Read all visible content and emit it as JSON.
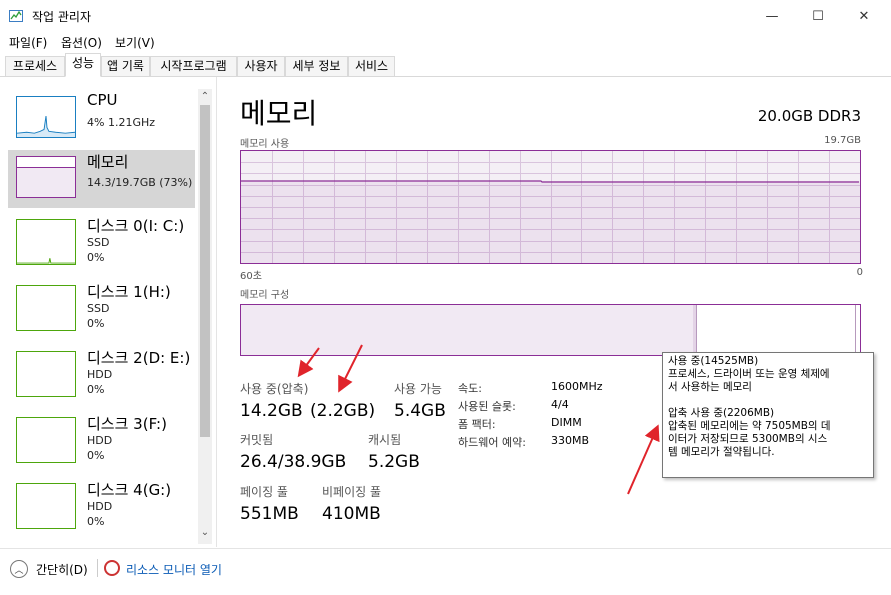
{
  "window": {
    "title": "작업 관리자",
    "minimize_icon": "—",
    "maximize_icon": "☐",
    "close_icon": "✕"
  },
  "menu": [
    "파일(F)",
    "옵션(O)",
    "보기(V)"
  ],
  "tabs": [
    "프로세스",
    "성능",
    "앱 기록",
    "시작프로그램",
    "사용자",
    "세부 정보",
    "서비스"
  ],
  "sidebar": {
    "items": [
      {
        "title": "CPU",
        "sub1": "4% 1.21GHz",
        "sub2": ""
      },
      {
        "title": "메모리",
        "sub1": "14.3/19.7GB (73%)",
        "sub2": ""
      },
      {
        "title": "디스크 0(I: C:)",
        "sub1": "SSD",
        "sub2": "0%"
      },
      {
        "title": "디스크 1(H:)",
        "sub1": "SSD",
        "sub2": "0%"
      },
      {
        "title": "디스크 2(D: E:)",
        "sub1": "HDD",
        "sub2": "0%"
      },
      {
        "title": "디스크 3(F:)",
        "sub1": "HDD",
        "sub2": "0%"
      },
      {
        "title": "디스크 4(G:)",
        "sub1": "HDD",
        "sub2": "0%"
      }
    ],
    "scroll_up": "⌃",
    "scroll_down": "⌄"
  },
  "main": {
    "title": "메모리",
    "spec": "20.0GB DDR3",
    "usage_label": "메모리 사용",
    "usage_max": "19.7GB",
    "usage_level": 0.73,
    "time_left": "60초",
    "time_right": "0",
    "composition_label": "메모리 구성",
    "stats": {
      "in_use_label": "사용 중(압축)",
      "in_use_value": "14.2GB",
      "compressed_value": "(2.2GB)",
      "available_label": "사용 가능",
      "available_value": "5.4GB",
      "committed_label": "커밋됨",
      "committed_value": "26.4/38.9GB",
      "cached_label": "캐시됨",
      "cached_value": "5.2GB",
      "paged_label": "페이징 풀",
      "paged_value": "551MB",
      "nonpaged_label": "비페이징 풀",
      "nonpaged_value": "410MB"
    },
    "specs": [
      {
        "key": "속도:",
        "value": "1600MHz"
      },
      {
        "key": "사용된 슬롯:",
        "value": "4/4"
      },
      {
        "key": "폼 팩터:",
        "value": "DIMM"
      },
      {
        "key": "하드웨어 예약:",
        "value": "330MB"
      }
    ]
  },
  "tooltip": {
    "line1": "사용 중(14525MB)",
    "line2": "프로세스, 드라이버 또는 운영 체제에",
    "line3": "서 사용하는 메모리",
    "line4": "압축 사용 중(2206MB)",
    "line5": "압축된 메모리에는 약 7505MB의 데",
    "line6": "이터가 저장되므로 5300MB의 시스",
    "line7": "템 메모리가 절약됩니다."
  },
  "footer": {
    "fewer_details": "간단히(D)",
    "resource_monitor": "리소스 모니터 열기",
    "fewer_icon": "︿"
  },
  "colors": {
    "memory_accent": "#8b2e96",
    "disk_accent": "#4da60c",
    "cpu_accent": "#1a7fc1",
    "arrow": "#e0242b"
  }
}
